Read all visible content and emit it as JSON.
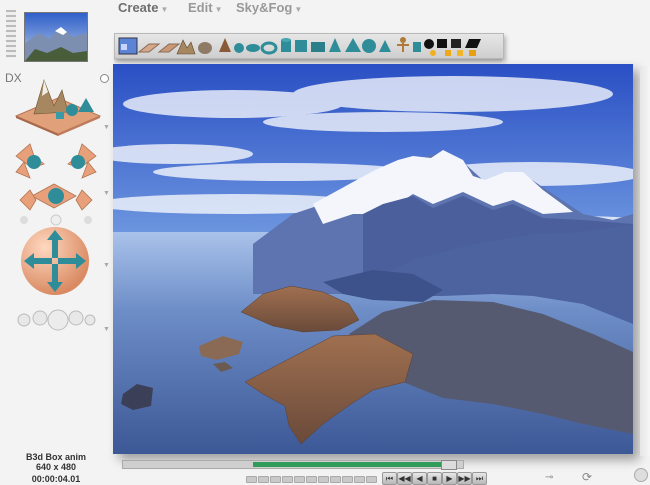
{
  "menu": {
    "create": "Create",
    "edit": "Edit",
    "sky_fog": "Sky&Fog"
  },
  "left_panel": {
    "dx_label": "DX"
  },
  "info": {
    "scene_name": "B3d Box anim",
    "resolution": "640 x 480",
    "time": "00:00:04.01"
  },
  "playback": {
    "buttons": [
      "⏮",
      "◀◀",
      "◀",
      "■",
      "▶",
      "▶▶",
      "⏭"
    ]
  },
  "colors": {
    "teal": "#2f8d99",
    "salmon": "#e8a07a",
    "gold": "#f0b020",
    "sky": "#5b83d6"
  }
}
